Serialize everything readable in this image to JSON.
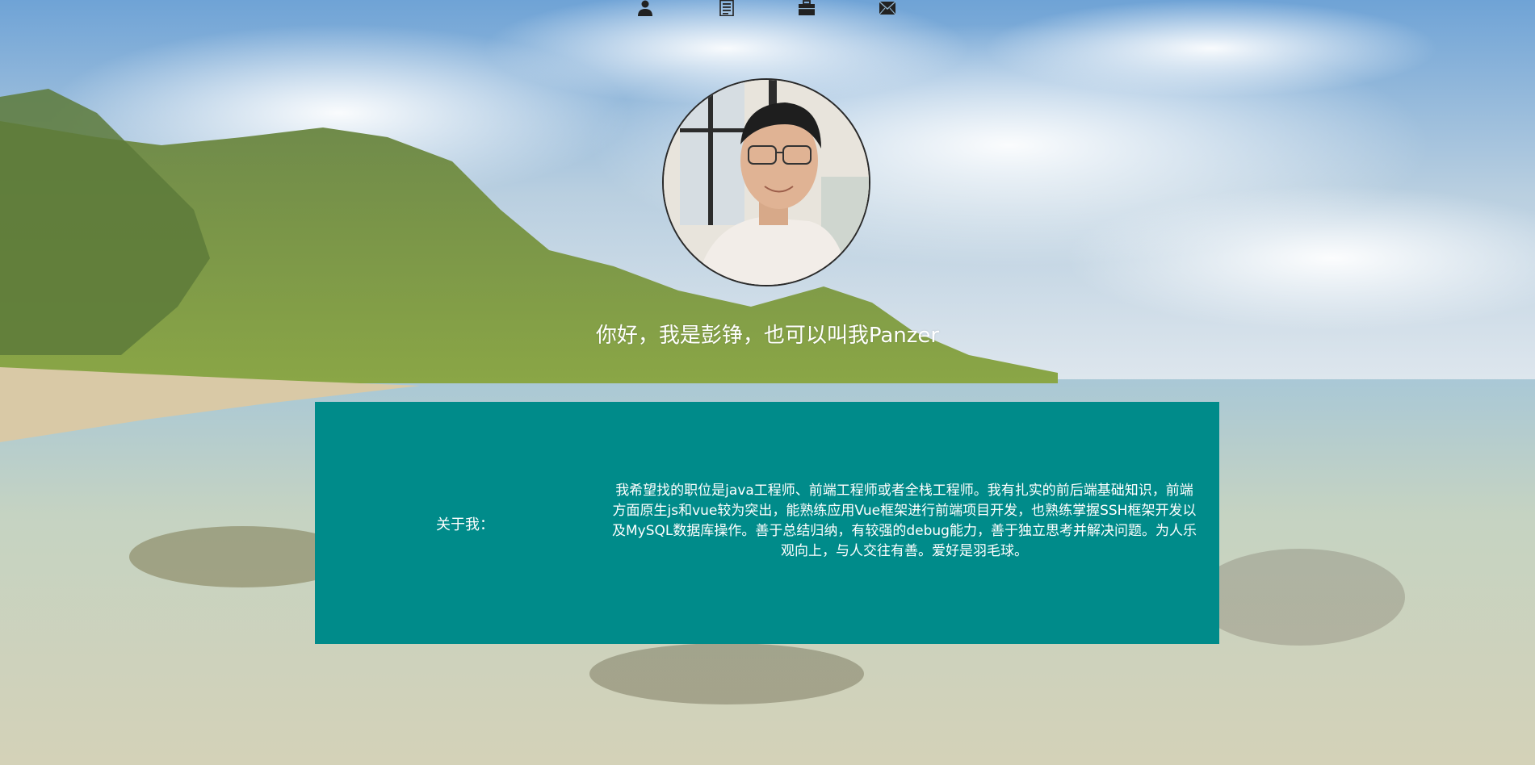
{
  "nav": {
    "items": [
      {
        "icon": "user-icon"
      },
      {
        "icon": "document-list-icon"
      },
      {
        "icon": "briefcase-icon"
      },
      {
        "icon": "envelope-icon"
      }
    ]
  },
  "hero": {
    "greeting": "你好，我是彭铮，也可以叫我Panzer"
  },
  "about": {
    "label": "关于我：",
    "text": "我希望找的职位是java工程师、前端工程师或者全栈工程师。我有扎实的前后端基础知识，前端方面原生js和vue较为突出，能熟练应用Vue框架进行前端项目开发，也熟练掌握SSH框架开发以及MySQL数据库操作。善于总结归纳，有较强的debug能力，善于独立思考并解决问题。为人乐观向上，与人交往有善。爱好是羽毛球。"
  },
  "colors": {
    "card": "#008b8a",
    "text": "#ffffff",
    "nav_icon": "#222222"
  }
}
